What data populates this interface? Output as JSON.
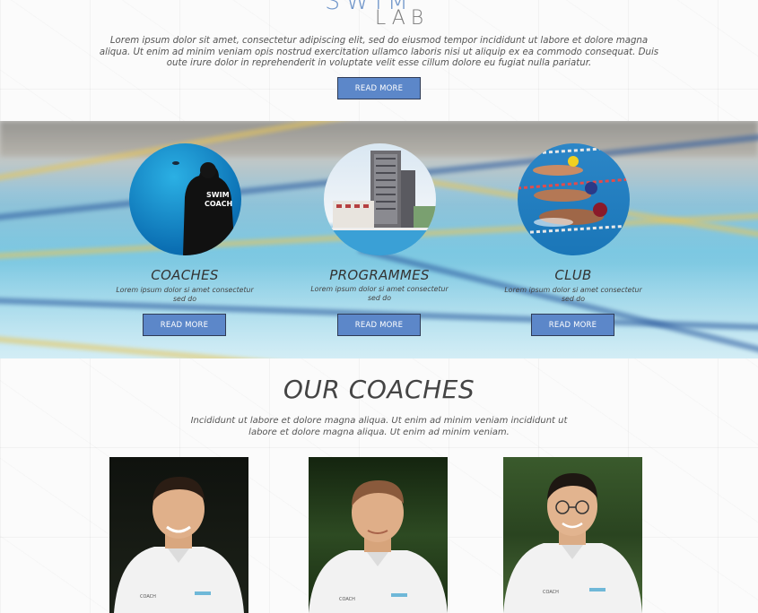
{
  "brand": {
    "line1": "SWIM",
    "line2": "LAB"
  },
  "intro": {
    "text": "Lorem ipsum dolor sit amet, consectetur adipiscing elit, sed do eiusmod tempor incididunt ut labore et dolore magna aliqua. Ut enim ad minim veniam opis nostrud exercitation ullamco laboris nisi ut aliquip ex ea commodo consequat. Duis oute irure dolor in reprehenderit in voluptate velit esse cillum dolore eu fugiat nulla pariatur.",
    "button": "READ MORE"
  },
  "features": [
    {
      "title": "COACHES",
      "text": "Lorem ipsum dolor si amet consectetur sed do",
      "button": "READ MORE"
    },
    {
      "title": "PROGRAMMES",
      "text": "Lorem ipsum dolor si amet consectetur sed do",
      "button": "READ MORE"
    },
    {
      "title": "CLUB",
      "text": "Lorem ipsum dolor si amet consectetur sed do",
      "button": "READ MORE"
    }
  ],
  "coaches": {
    "title": "OUR COACHES",
    "text": "Incididunt ut labore et dolore magna aliqua. Ut enim ad minim veniam incididunt ut labore et dolore magna aliqua. Ut enim ad minim veniam.",
    "shirt_label": "COACH"
  },
  "colors": {
    "accent": "#5c87c9",
    "button_border": "#2f3b55",
    "logo_swim": "#6f95c9"
  }
}
